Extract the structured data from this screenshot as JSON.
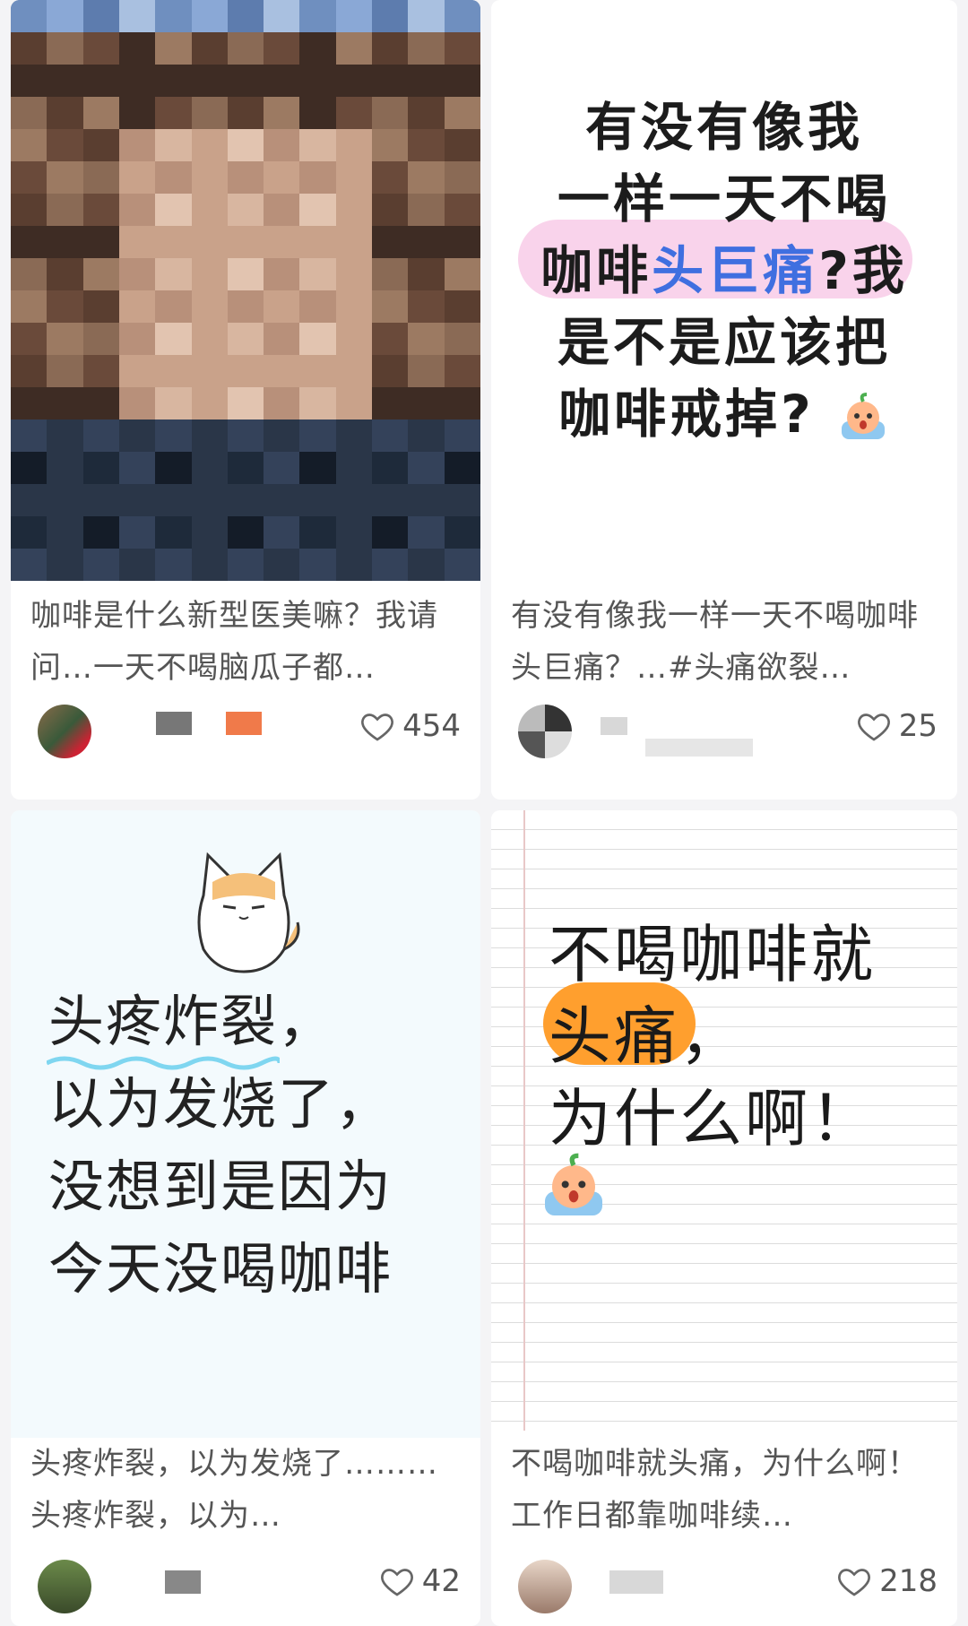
{
  "cards": [
    {
      "title": "咖啡是什么新型医美嘛？我请问…一天不喝脑瓜子都…",
      "likes": "454"
    },
    {
      "image_text": {
        "line1": "有没有像我",
        "line2": "一样一天不喝",
        "line3_prefix": "咖啡",
        "line3_highlight": "头巨痛",
        "line3_suffix": "?我",
        "line4": "是不是应该把",
        "line5": "咖啡戒掉?"
      },
      "title": "有没有像我一样一天不喝咖啡头巨痛？…#头痛欲裂…",
      "likes": "25"
    },
    {
      "image_text": {
        "line1": "头疼炸裂，",
        "line2": "以为发烧了，",
        "line3": "没想到是因为",
        "line4": "今天没喝咖啡"
      },
      "title": "头疼炸裂，以为发烧了……… 头疼炸裂，以为…",
      "likes": "42"
    },
    {
      "image_text": {
        "line1": "不喝咖啡就",
        "line2_highlight": "头痛",
        "line2_suffix": "，",
        "line3": "为什么啊！"
      },
      "title": "不喝咖啡就头痛，为什么啊！ 工作日都靠咖啡续…",
      "likes": "218"
    }
  ],
  "icons": {
    "like": "heart-outline-icon",
    "emoji": "crying-peach-emoji",
    "cat": "grumpy-cat-sticker"
  },
  "colors": {
    "highlight_blue": "#3f6fe0",
    "highlight_pink": "#f7c8e6",
    "highlight_orange": "#ff9f2e"
  }
}
